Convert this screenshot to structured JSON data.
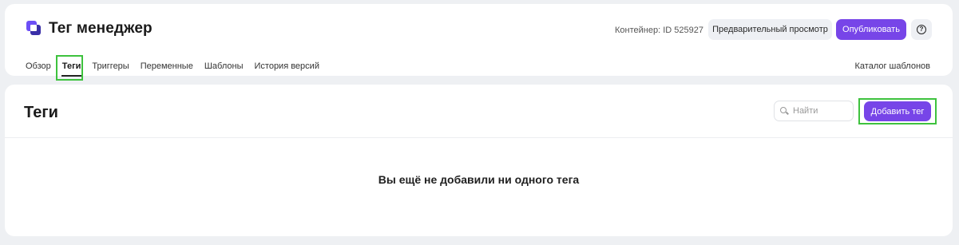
{
  "header": {
    "app_title": "Тег менеджер",
    "container_id": "Контейнер: ID 525927",
    "preview_label": "Предварительный просмотр",
    "publish_label": "Опубликовать",
    "help_glyph": "?",
    "catalog_label": "Каталог шаблонов",
    "nav": [
      "Обзор",
      "Теги",
      "Триггеры",
      "Переменные",
      "Шаблоны",
      "История версий"
    ],
    "active_nav": "Теги"
  },
  "main": {
    "title": "Теги",
    "search_placeholder": "Найти",
    "add_label": "Добавить тег",
    "empty_message": "Вы ещё не добавили ни одного тега"
  },
  "colors": {
    "accent": "#7745e8",
    "highlight": "#3ec23e"
  }
}
